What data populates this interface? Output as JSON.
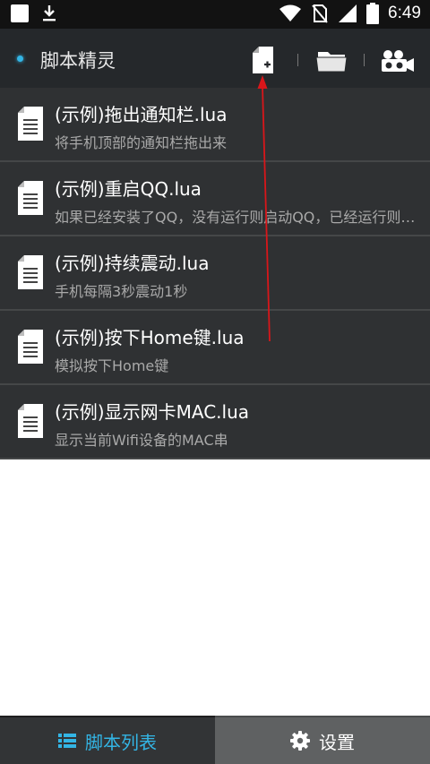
{
  "status_bar": {
    "time": "6:49",
    "icons": [
      "notification-square-icon",
      "download-icon",
      "wifi-icon",
      "no-sim-icon",
      "signal-icon",
      "battery-icon"
    ]
  },
  "action_bar": {
    "title": "脚本精灵",
    "icons": [
      "new-file-icon",
      "folder-icon",
      "record-icon"
    ]
  },
  "scripts": [
    {
      "title": "(示例)拖出通知栏.lua",
      "description": "将手机顶部的通知栏拖出来"
    },
    {
      "title": "(示例)重启QQ.lua",
      "description": "如果已经安装了QQ，没有运行则启动QQ，已经运行则重启QQ"
    },
    {
      "title": "(示例)持续震动.lua",
      "description": "手机每隔3秒震动1秒"
    },
    {
      "title": "(示例)按下Home键.lua",
      "description": "模拟按下Home键"
    },
    {
      "title": "(示例)显示网卡MAC.lua",
      "description": "显示当前Wifi设备的MAC串"
    }
  ],
  "tabs": {
    "script_list": "脚本列表",
    "settings": "设置"
  },
  "colors": {
    "accent": "#33b5e5",
    "annotation": "#d9161a"
  }
}
